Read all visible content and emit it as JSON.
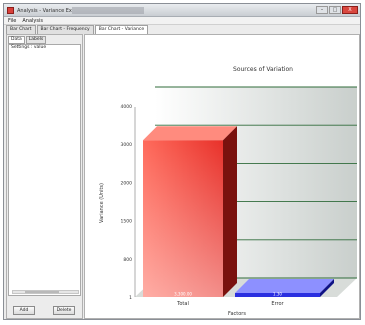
{
  "window": {
    "title": "Analysis - Variance Ex",
    "controls": {
      "minimize": "–",
      "maximize": "□",
      "close": "X"
    }
  },
  "menu": [
    "File",
    "Analysis"
  ],
  "tabs": [
    "Bar Chart",
    "Bar Chart - Frequency",
    "Bar Chart - Variance",
    ""
  ],
  "sidebar": {
    "subtabs": [
      "Data",
      "Labels"
    ],
    "items": [
      "Settings : value"
    ],
    "buttons": {
      "left": "Add",
      "right": "Delete"
    }
  },
  "chart_data": {
    "type": "bar",
    "title": "Sources of Variation",
    "xlabel": "Factors",
    "ylabel": "Variance (Units)",
    "ylim": [
      0,
      4000
    ],
    "y_ticks": [
      "4000",
      "3000",
      "2000",
      "1500",
      "800",
      "1"
    ],
    "categories": [
      "Total",
      "Error"
    ],
    "values": [
      3300,
      30
    ],
    "value_labels": [
      "3,300.00",
      "1.30"
    ],
    "colors": [
      "#e8312a",
      "#2b2fe0"
    ],
    "grid": true
  }
}
